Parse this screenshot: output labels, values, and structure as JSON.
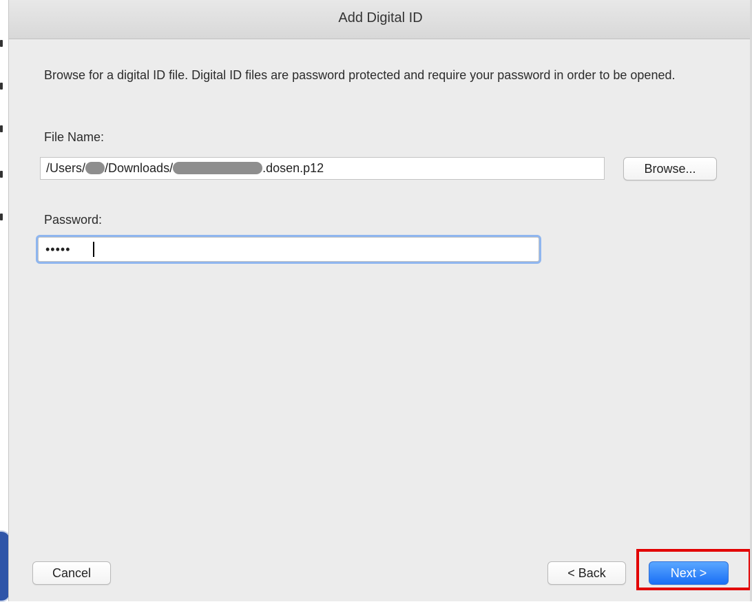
{
  "dialog": {
    "title": "Add Digital ID",
    "description": "Browse for a digital ID file. Digital ID files are password protected and require your password in order to be opened."
  },
  "file_name": {
    "label": "File Name:",
    "value_prefix": "/Users/",
    "value_middle": "/Downloads/",
    "value_suffix": ".dosen.p12",
    "browse_label": "Browse..."
  },
  "password": {
    "label": "Password:",
    "masked_value": "•••••"
  },
  "footer": {
    "cancel_label": "Cancel",
    "back_label": "< Back",
    "next_label": "Next >"
  },
  "colors": {
    "primary_button": "#1a6ff5",
    "highlight": "#e20000",
    "focus_ring": "#8fb6ef"
  }
}
